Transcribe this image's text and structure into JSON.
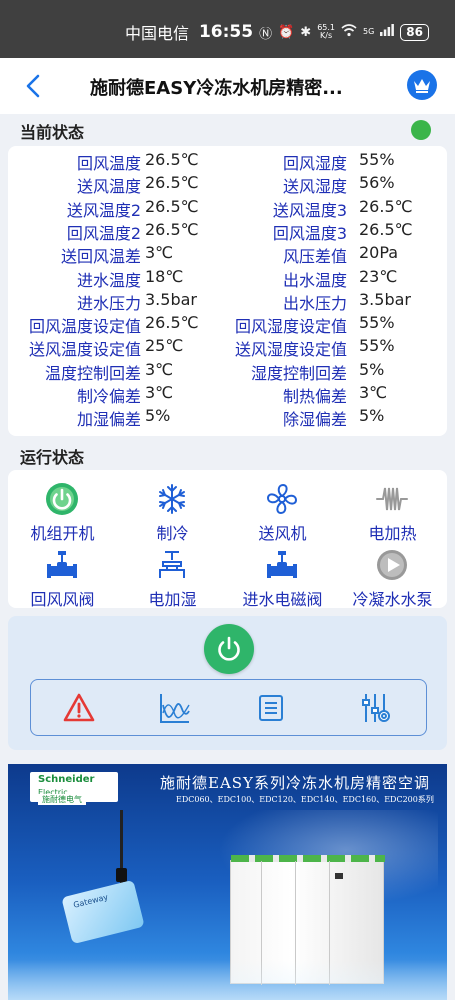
{
  "status_bar": {
    "carrier": "中国电信",
    "time": "16:55",
    "net_speed_value": "65.1",
    "net_speed_unit": "K/s",
    "signal_label": "5G",
    "battery": "86"
  },
  "header": {
    "title": "施耐德EASY冷冻水机房精密..."
  },
  "current_status": {
    "label": "当前状态",
    "indicator_color": "#3bb54a",
    "rows": [
      {
        "l1": "回风温度",
        "v1": "26.5℃",
        "l2": "回风湿度",
        "v2": "55%"
      },
      {
        "l1": "送风温度",
        "v1": "26.5℃",
        "l2": "送风湿度",
        "v2": "56%"
      },
      {
        "l1": "送风温度2",
        "v1": "26.5℃",
        "l2": "送风温度3",
        "v2": "26.5℃"
      },
      {
        "l1": "回风温度2",
        "v1": "26.5℃",
        "l2": "回风温度3",
        "v2": "26.5℃"
      },
      {
        "l1": "送回风温差",
        "v1": "3℃",
        "l2": "风压差值",
        "v2": "20Pa"
      },
      {
        "l1": "进水温度",
        "v1": "18℃",
        "l2": "出水温度",
        "v2": "23℃"
      },
      {
        "l1": "进水压力",
        "v1": "3.5bar",
        "l2": "出水压力",
        "v2": "3.5bar"
      },
      {
        "l1": "回风温度设定值",
        "v1": "26.5℃",
        "l2": "回风湿度设定值",
        "v2": "55%"
      },
      {
        "l1": "送风温度设定值",
        "v1": "25℃",
        "l2": "送风湿度设定值",
        "v2": "55%"
      },
      {
        "l1": "温度控制回差",
        "v1": "3℃",
        "l2": "湿度控制回差",
        "v2": "5%"
      },
      {
        "l1": "制冷偏差",
        "v1": "3℃",
        "l2": "制热偏差",
        "v2": "3℃"
      },
      {
        "l1": "加湿偏差",
        "v1": "5%",
        "l2": "除湿偏差",
        "v2": "5%"
      }
    ]
  },
  "run_status": {
    "label": "运行状态",
    "items": [
      {
        "label": "机组开机",
        "icon": "power-on-icon",
        "color": "#2fb56a"
      },
      {
        "label": "制冷",
        "icon": "snowflake-icon",
        "color": "#1f5fd6"
      },
      {
        "label": "送风机",
        "icon": "fan-icon",
        "color": "#1f5fd6"
      },
      {
        "label": "电加热",
        "icon": "heater-coil-icon",
        "color": "#999999"
      },
      {
        "label": "回风风阀",
        "icon": "valve-icon",
        "color": "#1f5fd6"
      },
      {
        "label": "电加湿",
        "icon": "humidifier-icon",
        "color": "#1f5fd6"
      },
      {
        "label": "进水电磁阀",
        "icon": "solenoid-valve-icon",
        "color": "#1f5fd6"
      },
      {
        "label": "冷凝水水泵",
        "icon": "pump-play-icon",
        "color": "#999999"
      }
    ]
  },
  "controls": {
    "power_color": "#2fb56a",
    "tools": [
      "alarm-warning-icon",
      "trend-chart-icon",
      "log-list-icon",
      "settings-sliders-icon"
    ]
  },
  "banner": {
    "brand_name": "Schneider",
    "brand_sub": "Electric",
    "brand_cn": "施耐德电气",
    "title": "施耐德EASY系列冷冻水机房精密空调",
    "models": "EDC060、EDC100、EDC120、EDC140、EDC160、EDC200系列",
    "gateway_label": "Gateway"
  }
}
